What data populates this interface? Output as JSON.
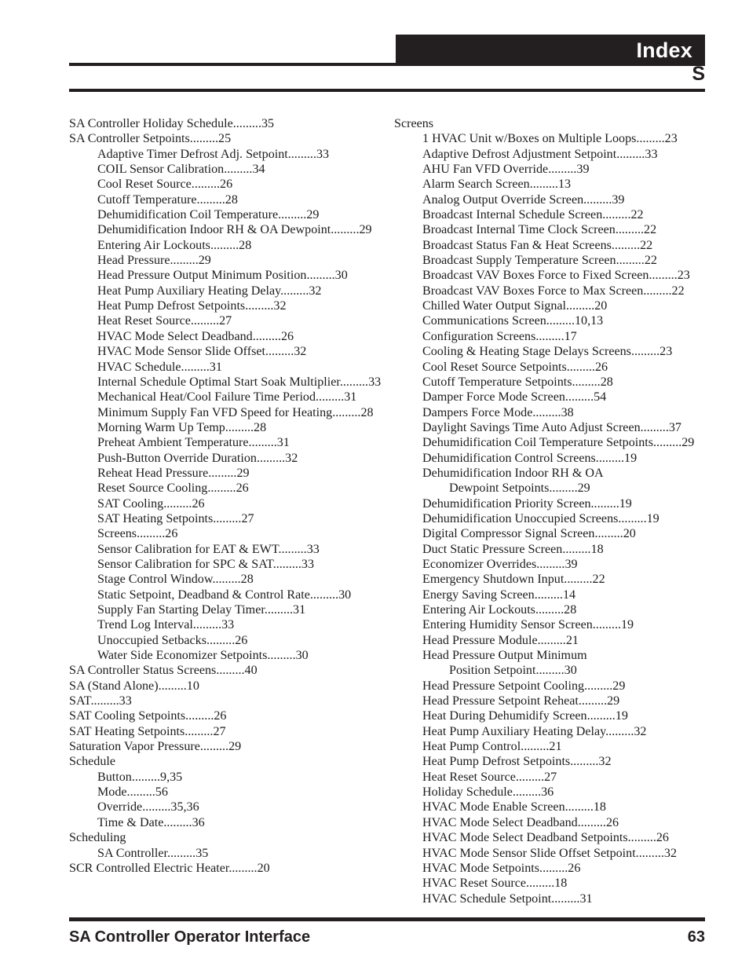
{
  "header": {
    "title": "Index",
    "letter": "S"
  },
  "footer": {
    "doc_title": "SA Controller Operator Interface",
    "page_number": "63"
  },
  "leader": ".........",
  "index": {
    "left_column": [
      {
        "level": 1,
        "text": "SA Controller Holiday Schedule",
        "page": "35"
      },
      {
        "level": 1,
        "text": "SA Controller Setpoints",
        "page": "25"
      },
      {
        "level": 2,
        "text": "Adaptive Timer Defrost Adj. Setpoint",
        "page": "33"
      },
      {
        "level": 2,
        "text": "COIL Sensor Calibration",
        "page": "34"
      },
      {
        "level": 2,
        "text": "Cool Reset Source",
        "page": "26"
      },
      {
        "level": 2,
        "text": "Cutoff Temperature",
        "page": "28"
      },
      {
        "level": 2,
        "text": "Dehumidification Coil Temperature",
        "page": "29"
      },
      {
        "level": 2,
        "text": "Dehumidification Indoor RH & OA Dewpoint",
        "page": "29"
      },
      {
        "level": 2,
        "text": "Entering Air Lockouts",
        "page": "28"
      },
      {
        "level": 2,
        "text": "Head Pressure",
        "page": "29"
      },
      {
        "level": 2,
        "text": "Head Pressure Output Minimum Position",
        "page": "30"
      },
      {
        "level": 2,
        "text": "Heat Pump Auxiliary Heating Delay",
        "page": "32"
      },
      {
        "level": 2,
        "text": "Heat Pump Defrost Setpoints",
        "page": "32"
      },
      {
        "level": 2,
        "text": "Heat Reset Source",
        "page": "27"
      },
      {
        "level": 2,
        "text": "HVAC Mode Select Deadband",
        "page": "26"
      },
      {
        "level": 2,
        "text": "HVAC Mode Sensor Slide Offset",
        "page": "32"
      },
      {
        "level": 2,
        "text": "HVAC Schedule",
        "page": "31"
      },
      {
        "level": 2,
        "text": "Internal Schedule Optimal Start Soak Multiplier",
        "page": "33"
      },
      {
        "level": 2,
        "text": "Mechanical Heat/Cool Failure Time Period",
        "page": "31"
      },
      {
        "level": 2,
        "text": "Minimum Supply Fan VFD Speed for Heating",
        "page": "28"
      },
      {
        "level": 2,
        "text": "Morning Warm Up Temp",
        "page": "28"
      },
      {
        "level": 2,
        "text": "Preheat Ambient Temperature",
        "page": "31"
      },
      {
        "level": 2,
        "text": "Push-Button Override Duration",
        "page": "32"
      },
      {
        "level": 2,
        "text": "Reheat Head Pressure",
        "page": "29"
      },
      {
        "level": 2,
        "text": "Reset Source Cooling",
        "page": "26"
      },
      {
        "level": 2,
        "text": "SAT Cooling",
        "page": "26"
      },
      {
        "level": 2,
        "text": "SAT Heating Setpoints",
        "page": "27"
      },
      {
        "level": 2,
        "text": "Screens",
        "page": "26"
      },
      {
        "level": 2,
        "text": "Sensor Calibration for EAT & EWT",
        "page": "33"
      },
      {
        "level": 2,
        "text": "Sensor Calibration for SPC & SAT",
        "page": "33"
      },
      {
        "level": 2,
        "text": "Stage Control Window",
        "page": "28"
      },
      {
        "level": 2,
        "text": "Static Setpoint, Deadband & Control Rate",
        "page": "30"
      },
      {
        "level": 2,
        "text": "Supply Fan Starting Delay Timer",
        "page": "31"
      },
      {
        "level": 2,
        "text": "Trend Log Interval",
        "page": "33"
      },
      {
        "level": 2,
        "text": "Unoccupied Setbacks",
        "page": "26"
      },
      {
        "level": 2,
        "text": "Water Side Economizer Setpoints",
        "page": "30"
      },
      {
        "level": 1,
        "text": "SA Controller Status Screens",
        "page": "40"
      },
      {
        "level": 1,
        "text": "SA (Stand Alone)",
        "page": "10"
      },
      {
        "level": 1,
        "text": "SAT",
        "page": "33"
      },
      {
        "level": 1,
        "text": "SAT Cooling Setpoints",
        "page": "26"
      },
      {
        "level": 1,
        "text": "SAT Heating Setpoints",
        "page": "27"
      },
      {
        "level": 1,
        "text": "Saturation Vapor Pressure",
        "page": "29"
      },
      {
        "level": 1,
        "text": "Schedule",
        "page": ""
      },
      {
        "level": 2,
        "text": "Button",
        "page": "9,35"
      },
      {
        "level": 2,
        "text": "Mode",
        "page": "56"
      },
      {
        "level": 2,
        "text": "Override",
        "page": "35,36"
      },
      {
        "level": 2,
        "text": "Time & Date",
        "page": "36"
      },
      {
        "level": 1,
        "text": "Scheduling",
        "page": ""
      },
      {
        "level": 2,
        "text": "SA Controller",
        "page": "35"
      },
      {
        "level": 1,
        "text": "SCR Controlled Electric Heater",
        "page": "20"
      }
    ],
    "right_column": [
      {
        "level": 1,
        "text": "Screens",
        "page": ""
      },
      {
        "level": 2,
        "text": "1 HVAC Unit w/Boxes on Multiple Loops",
        "page": "23"
      },
      {
        "level": 2,
        "text": "Adaptive Defrost Adjustment Setpoint",
        "page": "33"
      },
      {
        "level": 2,
        "text": "AHU Fan VFD Override",
        "page": "39"
      },
      {
        "level": 2,
        "text": "Alarm Search Screen",
        "page": "13"
      },
      {
        "level": 2,
        "text": "Analog Output Override Screen",
        "page": "39"
      },
      {
        "level": 2,
        "text": "Broadcast Internal Schedule Screen",
        "page": "22"
      },
      {
        "level": 2,
        "text": "Broadcast Internal Time Clock Screen",
        "page": "22"
      },
      {
        "level": 2,
        "text": "Broadcast Status Fan & Heat Screens",
        "page": "22"
      },
      {
        "level": 2,
        "text": "Broadcast Supply Temperature Screen",
        "page": "22"
      },
      {
        "level": 2,
        "text": "Broadcast VAV Boxes Force to Fixed Screen",
        "page": "23"
      },
      {
        "level": 2,
        "text": "Broadcast VAV Boxes Force to Max Screen",
        "page": "22"
      },
      {
        "level": 2,
        "text": "Chilled Water Output Signal",
        "page": "20"
      },
      {
        "level": 2,
        "text": "Communications Screen",
        "page": "10,13"
      },
      {
        "level": 2,
        "text": "Configuration Screens",
        "page": "17"
      },
      {
        "level": 2,
        "text": "Cooling & Heating Stage Delays Screens",
        "page": "23"
      },
      {
        "level": 2,
        "text": "Cool Reset Source Setpoints",
        "page": "26"
      },
      {
        "level": 2,
        "text": "Cutoff Temperature Setpoints",
        "page": "28"
      },
      {
        "level": 2,
        "text": "Damper Force Mode Screen",
        "page": "54"
      },
      {
        "level": 2,
        "text": "Dampers Force Mode",
        "page": "38"
      },
      {
        "level": 2,
        "text": "Daylight Savings Time Auto Adjust Screen",
        "page": "37"
      },
      {
        "level": 2,
        "text": "Dehumidification Coil Temperature Setpoints",
        "page": "29"
      },
      {
        "level": 2,
        "text": "Dehumidification Control Screens",
        "page": "19"
      },
      {
        "level": 2,
        "text": "Dehumidification Indoor RH & OA",
        "page": ""
      },
      {
        "level": 3,
        "text": "Dewpoint Setpoints",
        "page": "29"
      },
      {
        "level": 2,
        "text": "Dehumidification Priority Screen",
        "page": "19"
      },
      {
        "level": 2,
        "text": "Dehumidification Unoccupied Screens",
        "page": "19"
      },
      {
        "level": 2,
        "text": "Digital Compressor Signal Screen",
        "page": "20"
      },
      {
        "level": 2,
        "text": "Duct Static Pressure Screen",
        "page": "18"
      },
      {
        "level": 2,
        "text": "Economizer Overrides",
        "page": "39"
      },
      {
        "level": 2,
        "text": "Emergency Shutdown Input",
        "page": "22"
      },
      {
        "level": 2,
        "text": "Energy Saving Screen",
        "page": "14"
      },
      {
        "level": 2,
        "text": "Entering Air Lockouts",
        "page": "28"
      },
      {
        "level": 2,
        "text": "Entering Humidity Sensor Screen",
        "page": "19"
      },
      {
        "level": 2,
        "text": "Head Pressure Module",
        "page": "21"
      },
      {
        "level": 2,
        "text": "Head Pressure Output Minimum",
        "page": ""
      },
      {
        "level": 3,
        "text": "Position Setpoint",
        "page": "30"
      },
      {
        "level": 2,
        "text": "Head Pressure Setpoint Cooling",
        "page": "29"
      },
      {
        "level": 2,
        "text": "Head Pressure Setpoint Reheat",
        "page": "29"
      },
      {
        "level": 2,
        "text": "Heat During Dehumidify Screen",
        "page": "19"
      },
      {
        "level": 2,
        "text": "Heat Pump Auxiliary Heating Delay",
        "page": "32"
      },
      {
        "level": 2,
        "text": "Heat Pump Control",
        "page": "21"
      },
      {
        "level": 2,
        "text": "Heat Pump Defrost Setpoints",
        "page": "32"
      },
      {
        "level": 2,
        "text": "Heat Reset Source",
        "page": "27"
      },
      {
        "level": 2,
        "text": "Holiday Schedule",
        "page": "36"
      },
      {
        "level": 2,
        "text": "HVAC Mode Enable Screen",
        "page": "18"
      },
      {
        "level": 2,
        "text": "HVAC Mode Select Deadband",
        "page": "26"
      },
      {
        "level": 2,
        "text": "HVAC Mode Select Deadband Setpoints",
        "page": "26"
      },
      {
        "level": 2,
        "text": "HVAC Mode Sensor Slide Offset Setpoint",
        "page": "32"
      },
      {
        "level": 2,
        "text": "HVAC Mode Setpoints",
        "page": "26"
      },
      {
        "level": 2,
        "text": "HVAC Reset Source",
        "page": "18"
      },
      {
        "level": 2,
        "text": "HVAC Schedule Setpoint",
        "page": "31"
      }
    ]
  }
}
